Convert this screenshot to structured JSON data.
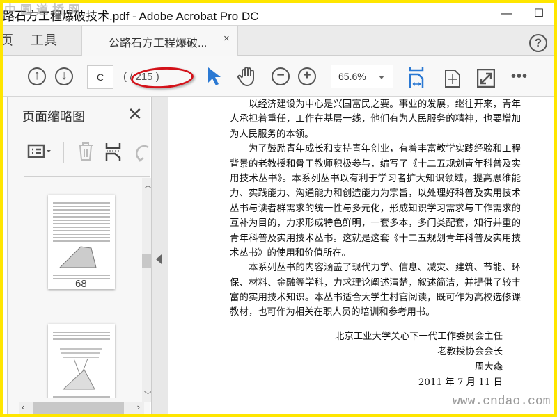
{
  "window": {
    "title": "路石方工程爆破技术.pdf - Adobe Acrobat Pro DC",
    "watermark_top": "中国道桥网",
    "minimize": "—",
    "maximize": "☐"
  },
  "tabs": {
    "home_partial": "页",
    "tools": "工具",
    "document": "公路石方工程爆破...",
    "close": "×",
    "help": "?"
  },
  "toolbar": {
    "page_input": "C",
    "page_count": "( / 215 )",
    "zoom": "65.6%",
    "more": "•••"
  },
  "panel": {
    "title": "页面缩略图",
    "close": "✕",
    "thumb_page_number": "68"
  },
  "document": {
    "paragraphs": [
      [
        "以经济建设为中心是兴国富民之要。事业的发展，继往开来，青年",
        "人承担着重任，工作在基层一线，他们有为人民服务的精神，也要增加",
        "为人民服务的本领。"
      ],
      [
        "为了鼓励青年成长和支持青年创业，有着丰富教学实践经验和工程",
        "背景的老教授和骨干教师积极参与，编写了《十二五规划青年科普及实",
        "用技术丛书》。本系列丛书以有利于学习者扩大知识领域，提高思维能",
        "力、实践能力、沟通能力和创造能力为宗旨，以处理好科普及实用技术",
        "丛书与读者群需求的统一性与多元化，形成知识学习需求与工作需求的",
        "互补为目的，力求形成特色鲜明，一套多本，多门类配套，知行并重的",
        "青年科普及实用技术丛书。这就是这套《十二五规划青年科普及实用技",
        "术丛书》的使用和价值所在。"
      ],
      [
        "本系列丛书的内容涵盖了现代力学、信息、减灾、建筑、节能、环",
        "保、材料、金融等学科，力求理论阐述清楚，叙述简洁，并提供了较丰",
        "富的实用技术知识。本丛书适合大学生村官阅读，既可作为高校选修课",
        "教材，也可作为相关在职人员的培训和参考用书。"
      ]
    ],
    "signature": [
      "北京工业大学关心下一代工作委员会主任",
      "老教授协会会长",
      "周大森",
      "2011 年 7 月 11 日"
    ]
  },
  "watermark_bottom": "www.cndao.com",
  "colors": {
    "accent": "#2b79d3",
    "annotation": "#d3121a",
    "frame": "#ffe600"
  }
}
